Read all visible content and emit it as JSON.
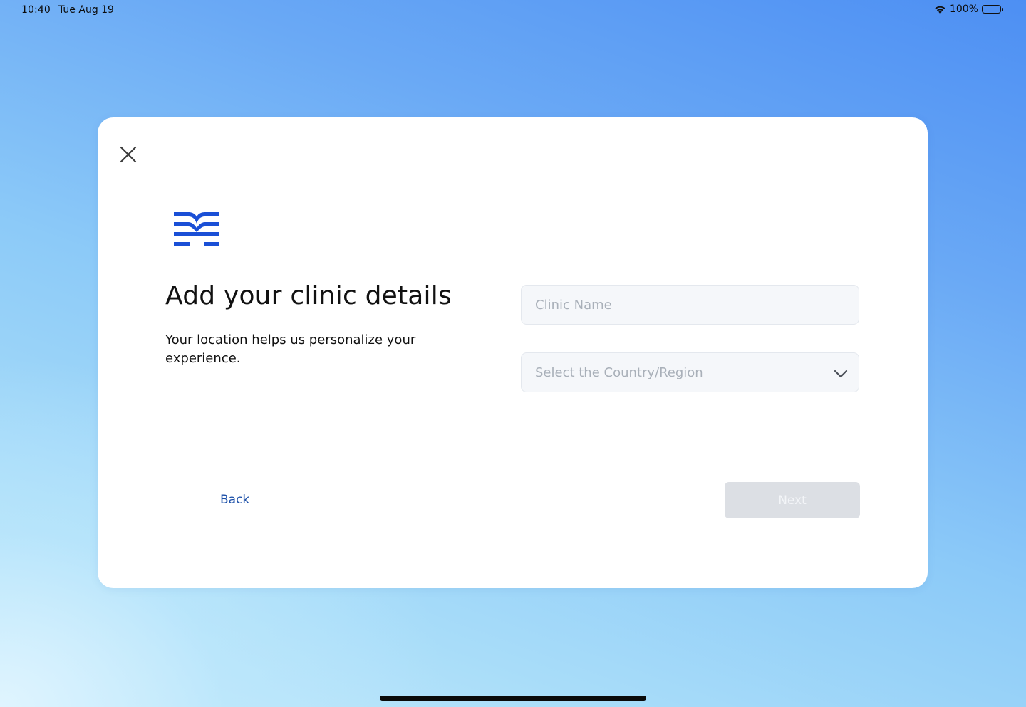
{
  "status_bar": {
    "time": "10:40",
    "date": "Tue Aug 19",
    "battery": "100%"
  },
  "card": {
    "logo_color": "#1a4fd6",
    "title": "Add your clinic details",
    "subtitle": "Your location helps us personalize your experience.",
    "clinic_name": {
      "value": "",
      "placeholder": "Clinic Name"
    },
    "country_select": {
      "placeholder": "Select the Country/Region",
      "selected": ""
    },
    "back_label": "Back",
    "next_label": "Next",
    "next_enabled": false
  },
  "colors": {
    "accent": "#1b4fa8",
    "disabled_button": "#dcdfe4",
    "background_top": "#4d8ff3",
    "background_bottom": "#c6ebfb"
  },
  "icons": [
    "wifi-icon",
    "battery-icon",
    "close-icon",
    "clinic-logo",
    "chevron-down-icon"
  ]
}
